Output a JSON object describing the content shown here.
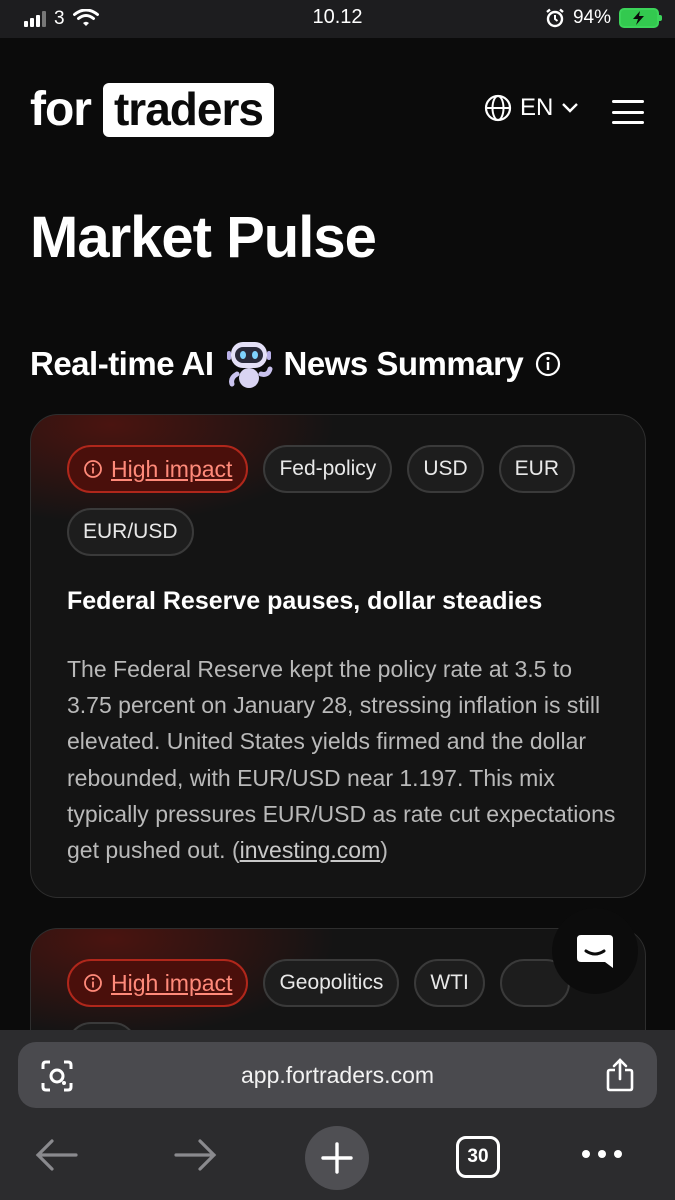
{
  "status_bar": {
    "carrier": "3",
    "time": "10.12",
    "battery_percent": "94%"
  },
  "header": {
    "logo_prefix": "for",
    "logo_box": "traders",
    "language": "EN"
  },
  "page_title": "Market Pulse",
  "section": {
    "title_left": "Real-time AI",
    "title_right": "News Summary"
  },
  "cards": [
    {
      "tags": [
        "High impact",
        "Fed-policy",
        "USD",
        "EUR",
        "EUR/USD"
      ],
      "headline": "Federal Reserve pauses, dollar steadies",
      "body": "The Federal Reserve kept the policy rate at 3.5 to 3.75 percent on January 28, stressing inflation is still elevated. United States yields firmed and the dollar rebounded, with EUR/USD near 1.197. This mix typically pressures EUR/USD as rate cut expectations get pushed out. (",
      "source": "investing.com",
      "body_end": ")"
    },
    {
      "tags": [
        "High impact",
        "Geopolitics",
        "WTI"
      ]
    }
  ],
  "browser": {
    "url": "app.fortraders.com",
    "tab_count": "30"
  },
  "colors": {
    "background": "#0b0b0b",
    "impact_bg": "#4a0f0b",
    "impact_border": "#b0271b",
    "impact_text": "#ff8a7a",
    "battery": "#33c94f"
  }
}
